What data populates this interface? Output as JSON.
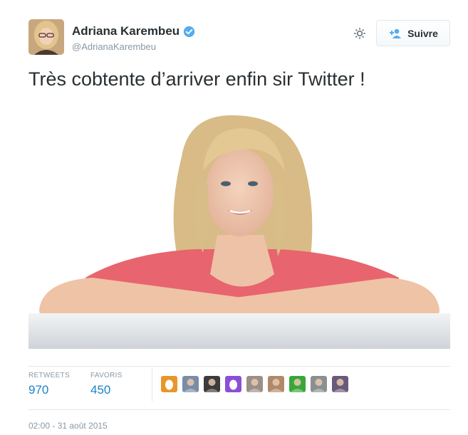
{
  "author": {
    "display_name": "Adriana Karembeu",
    "handle": "@AdrianaKarembeu",
    "verified": true
  },
  "actions": {
    "follow_label": "Suivre",
    "settings_icon": "gear-icon",
    "follow_icon": "add-user-icon"
  },
  "tweet": {
    "text": "Très cobtente d’arriver enfin sir Twitter !"
  },
  "stats": {
    "retweets_label": "RETWEETS",
    "retweets_value": "970",
    "favorites_label": "FAVORIS",
    "favorites_value": "450"
  },
  "favoriters": [
    {
      "kind": "egg",
      "color": "#e8962a"
    },
    {
      "kind": "photo",
      "color": "#7a8ca6"
    },
    {
      "kind": "photo",
      "color": "#3b3b3b"
    },
    {
      "kind": "egg",
      "color": "#8a4fd6"
    },
    {
      "kind": "photo",
      "color": "#9c8f86"
    },
    {
      "kind": "photo",
      "color": "#b08a68"
    },
    {
      "kind": "photo",
      "color": "#3aa63a"
    },
    {
      "kind": "photo",
      "color": "#8a9090"
    },
    {
      "kind": "photo",
      "color": "#6a5a7a"
    }
  ],
  "timestamp": "02:00 - 31 août 2015",
  "colors": {
    "link": "#1a84c7",
    "verified": "#55acee",
    "muted": "#8899a6",
    "text": "#292f33"
  }
}
